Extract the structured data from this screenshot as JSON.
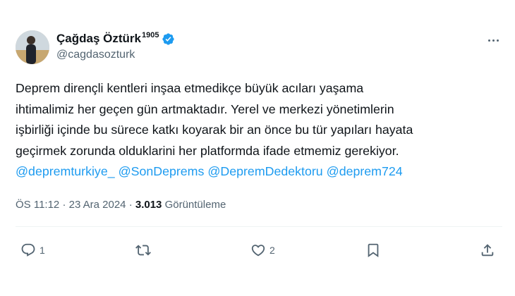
{
  "tweet": {
    "author": {
      "display_name": "Çağdaş Öztürk",
      "name_suffix": "1905",
      "handle": "@cagdasozturk",
      "verified": true
    },
    "text_lines": [
      "Deprem dirençli kentleri inşaa etmedikçe büyük acıları yaşama",
      "ihtimalimiz her geçen gün artmaktadır. Yerel ve merkezi yönetimlerin",
      "işbirliği içinde bu sürece katkı koyarak bir an önce bu tür yapıları hayata",
      "geçirmek zorunda olduklarini her platformda ifade etmemiz gerekiyor."
    ],
    "mentions": [
      "@depremturkiye_",
      "@SonDeprems",
      "@DepremDedektoru",
      "@deprem724"
    ],
    "meta": {
      "time": "ÖS 11:12",
      "separator": "·",
      "date": "23 Ara 2024",
      "views_count": "3.013",
      "views_label": "Görüntüleme"
    },
    "actions": {
      "reply_count": "1",
      "retweet_count": "",
      "like_count": "2"
    }
  },
  "colors": {
    "accent": "#1d9bf0",
    "text": "#0f1419",
    "muted": "#536471",
    "divider": "#eff3f4"
  },
  "icons": [
    "verified-badge-icon",
    "more-icon",
    "reply-icon",
    "retweet-icon",
    "like-icon",
    "bookmark-icon",
    "share-icon"
  ]
}
